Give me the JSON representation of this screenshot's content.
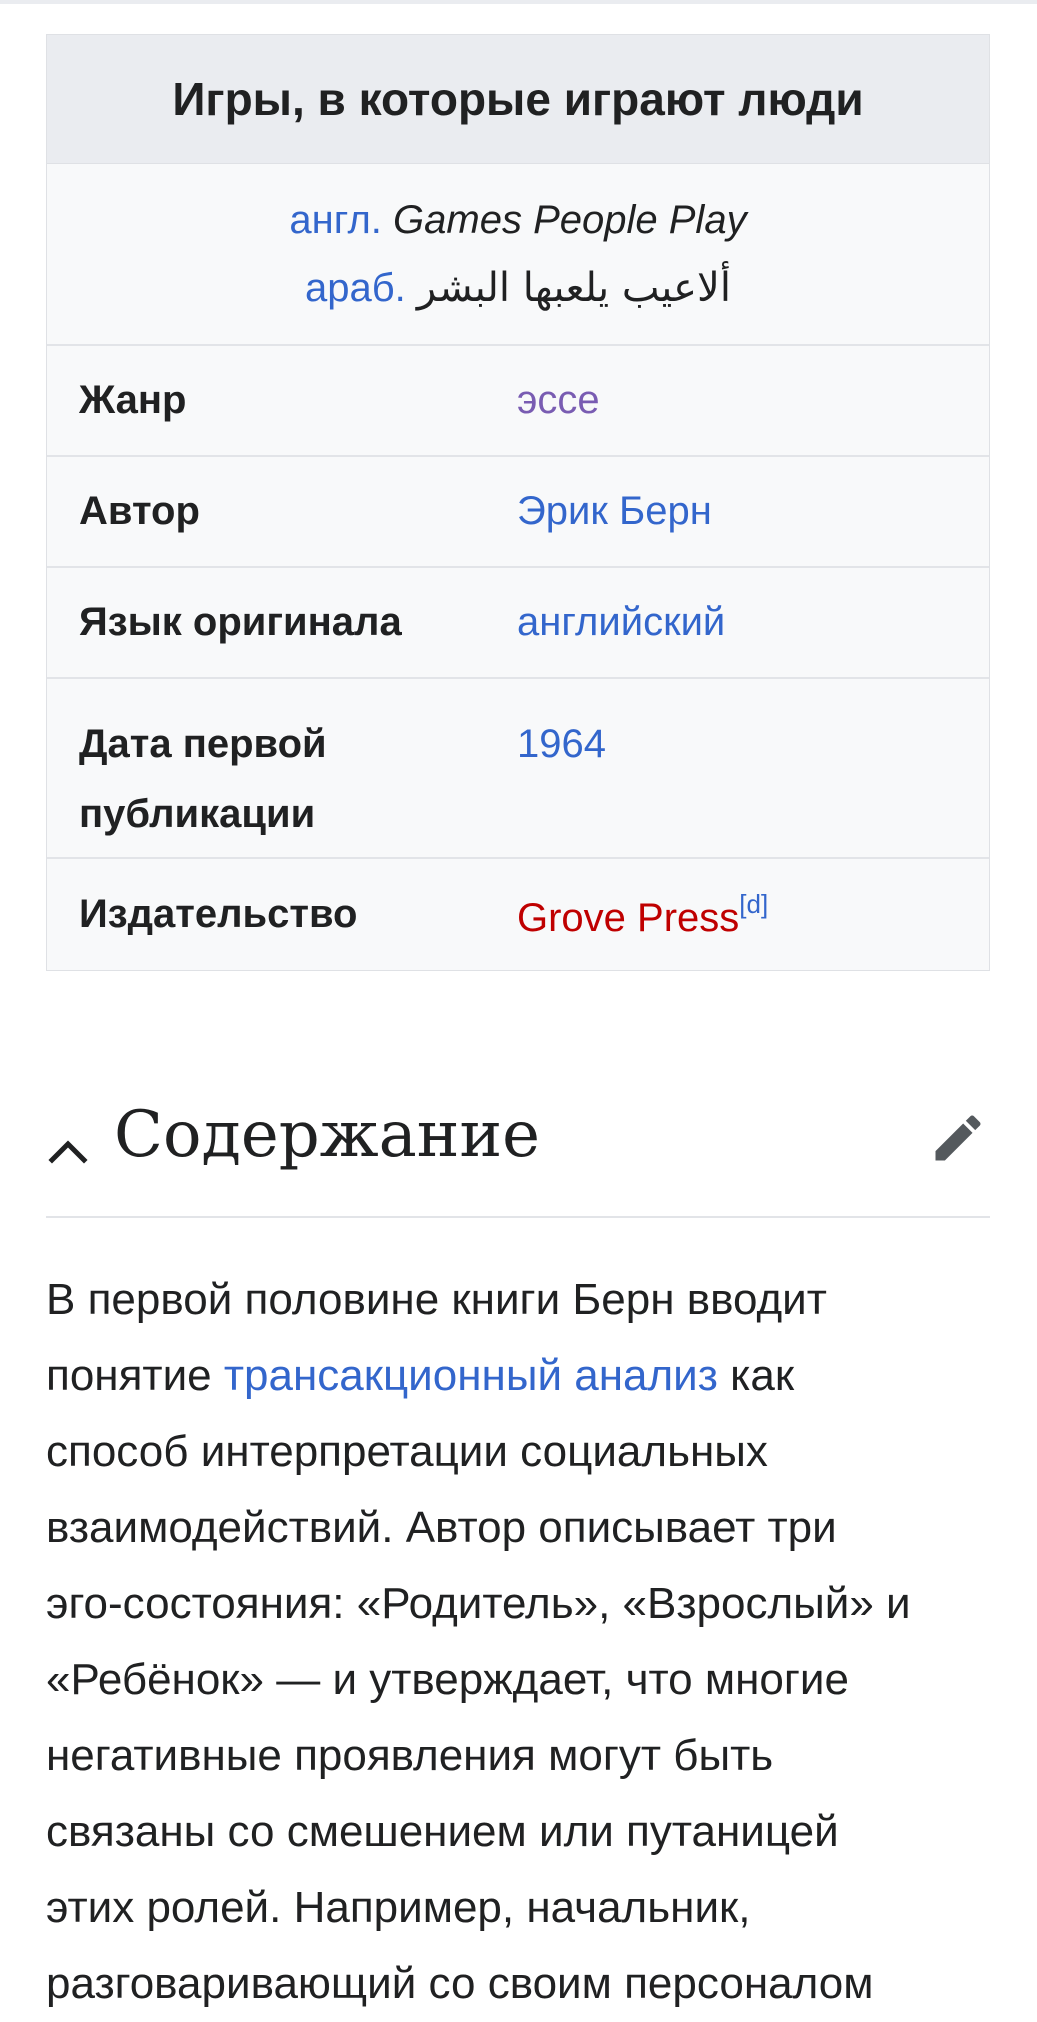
{
  "infobox": {
    "title": "Игры, в которые играют люди",
    "original_titles": [
      {
        "lang_label": "англ.",
        "text": "Games People Play"
      },
      {
        "lang_label": "араб.",
        "text": "ألاعيب يلعبها البشر"
      }
    ],
    "rows": [
      {
        "label": "Жанр",
        "value": "эссе"
      },
      {
        "label": "Автор",
        "value": "Эрик Берн"
      },
      {
        "label": "Язык оригинала",
        "value": "английский"
      },
      {
        "label_line1": "Дата первой",
        "label_line2": "публикации",
        "value": "1964"
      },
      {
        "label": "Издательство",
        "value": "Grove Press",
        "value_sup": "[d]"
      }
    ]
  },
  "section": {
    "title": "Содержание",
    "chevron_icon": "chevron-up-icon",
    "edit_icon": "pencil-icon"
  },
  "paragraph": {
    "line1": "В первой половине книги Берн вводит",
    "part_before_link": "понятие ",
    "link": "трансакционный анализ",
    "part_after_link": " как",
    "line3": "способ интерпретации социальных",
    "line4": "взаимодействий. Автор описывает три",
    "line5": "эго-состояния: «Родитель», «Взрослый» и",
    "line6": "«Ребёнок» — и утверждает, что многие",
    "line7": "негативные проявления могут быть",
    "line8": "связаны со смешением или путаницей",
    "line9": "этих ролей. Например, начальник,",
    "line10": "разговаривающий со своим персоналом"
  },
  "colors": {
    "link": "#3366cc",
    "visited_link": "#795cb2",
    "red_link": "#bf0000",
    "infobox_header_bg": "#eaecf0",
    "infobox_bg": "#f8f9fa",
    "text": "#202122"
  }
}
